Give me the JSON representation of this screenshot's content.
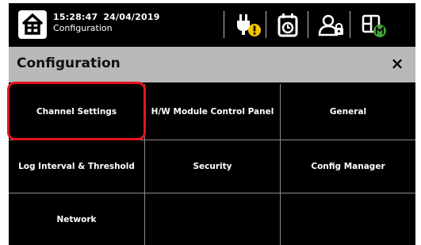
{
  "status_bar": {
    "time": "15:28:47",
    "date": "24/04/2019",
    "screen": "Configuration",
    "icons": [
      "home-icon",
      "power-warning-icon",
      "schedule-icon",
      "user-lock-icon",
      "module-icon"
    ]
  },
  "header": {
    "title": "Configuration",
    "close_label": "×"
  },
  "menu": {
    "items": [
      {
        "label": "Channel Settings",
        "highlighted": true
      },
      {
        "label": "H/W Module Control Panel"
      },
      {
        "label": "General"
      },
      {
        "label": "Log Interval & Threshold"
      },
      {
        "label": "Security"
      },
      {
        "label": "Config Manager"
      },
      {
        "label": "Network"
      },
      {
        "label": ""
      },
      {
        "label": ""
      }
    ]
  },
  "colors": {
    "accent_highlight": "#e2161b",
    "warning": "#f5c400",
    "status_green": "#3fa535"
  }
}
